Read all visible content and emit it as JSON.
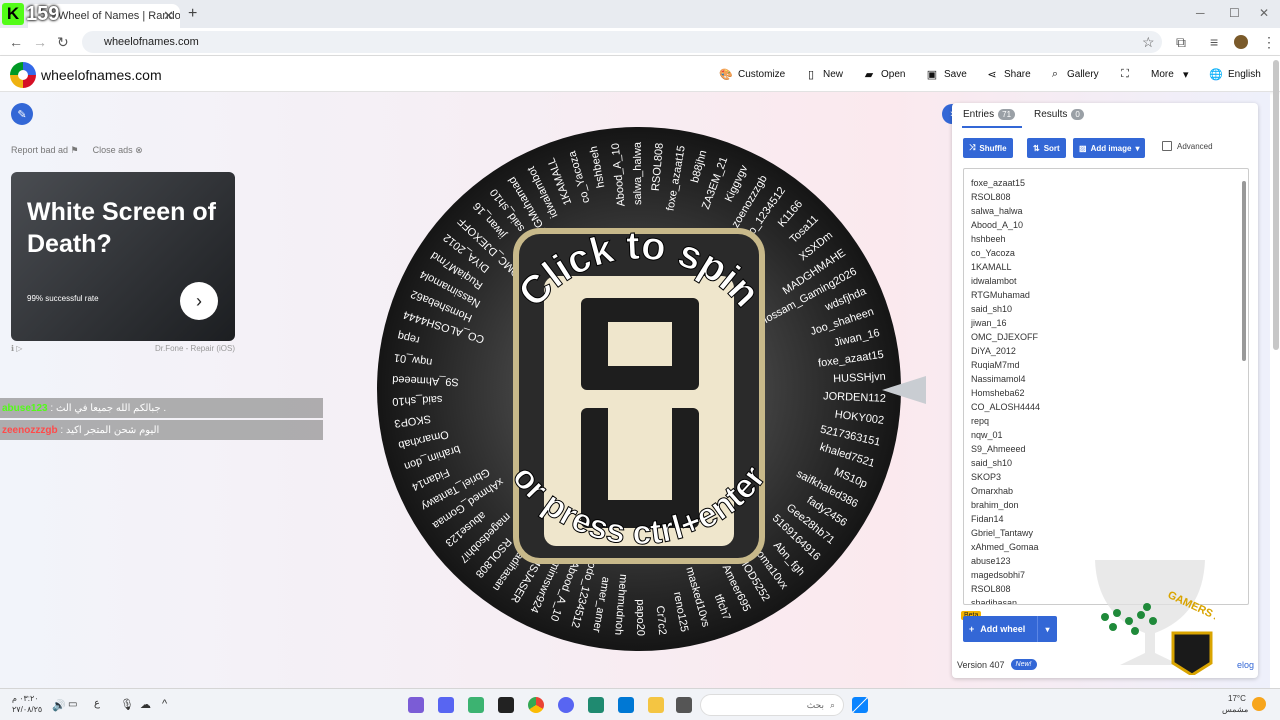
{
  "browser": {
    "tab_title": "Wheel of Names | Random name picker",
    "url": "wheelofnames.com",
    "overlay_counter": "159"
  },
  "header": {
    "site_title": "wheelofnames.com",
    "customize": "Customize",
    "new": "New",
    "open": "Open",
    "save": "Save",
    "share": "Share",
    "gallery": "Gallery",
    "more": "More",
    "language": "English"
  },
  "ads": {
    "report": "Report bad ad",
    "close": "Close ads",
    "headline": "White Screen of Death?",
    "rate": "99% successful rate",
    "advertiser": "Dr.Fone - Repair (iOS)"
  },
  "chat": [
    {
      "user": "abuse123",
      "message": "جبالكم الله جميعا في الث ."
    },
    {
      "user": "zeenozzzgb",
      "message": "اليوم شحن المتجر اكيد"
    }
  ],
  "wheel": {
    "spin_text": "Click to spin",
    "press_text": "or press ctrl+enter",
    "names": [
      "foxe_azaat15",
      "b88jhn",
      "ZA3EM_21",
      "Kiggvgv",
      "zoenozzzgb",
      "Dodo_1234512",
      "K1166",
      "Tosa11",
      "XSXDm",
      "MADGHMAHE",
      "Hossam_Gaming2026",
      "wdsfjhda",
      "Joo_shaheen",
      "Jiwan_16",
      "foxe_azaat15",
      "HUSSHjvn",
      "JORDEN112",
      "HOKY002",
      "5217363151",
      "khaled7521",
      "MS10p",
      "saifkhaled386",
      "fady2456",
      "Gee28hb71",
      "5169164916",
      "Abn_fgh",
      "edSoma10vx",
      "M7MOD5252",
      "Ameer695",
      "tffch7",
      "masked10vs",
      "reno125",
      "Cr7c2",
      "papo20",
      "mehmudnoh",
      "amer_amer",
      "Dodo_1234512",
      "Abood_A_10",
      "skhmimswr924",
      "MSJASER",
      "shadihasan",
      "RSOL808",
      "magedsobhi7",
      "abuse123",
      "xAhmed_Gomaa",
      "Gbriel_Tantawy",
      "Fidan14",
      "brahim_don",
      "Omarxhab",
      "SKOP3",
      "said_sh10",
      "S9_Ahmeeed",
      "nqw_01",
      "repq",
      "CO_ALOSH4444",
      "Homsheba62",
      "Nassimamol4",
      "RuqiaM7md",
      "DiYA_2012",
      "OMC_DJEXOFF",
      "jiwan_16",
      "said_sh10",
      "RTGMuhamad",
      "idwalambot",
      "1KAMALL",
      "co_Yacoza",
      "hshbeeh",
      "Abood_A_10",
      "salwa_halwa",
      "RSOL808"
    ]
  },
  "panel": {
    "entries_label": "Entries",
    "entries_count": "71",
    "results_label": "Results",
    "results_count": "0",
    "shuffle": "Shuffle",
    "sort": "Sort",
    "add_image": "Add image",
    "advanced": "Advanced",
    "entries": [
      "foxe_azaat15",
      "RSOL808",
      "salwa_halwa",
      "Abood_A_10",
      "hshbeeh",
      "co_Yacoza",
      "1KAMALL",
      "idwalambot",
      "RTGMuhamad",
      "said_sh10",
      "jiwan_16",
      "OMC_DJEXOFF",
      "DiYA_2012",
      "RuqiaM7md",
      "Nassimamol4",
      "Homsheba62",
      "CO_ALOSH4444",
      "repq",
      "nqw_01",
      "S9_Ahmeeed",
      "said_sh10",
      "SKOP3",
      "Omarxhab",
      "brahim_don",
      "Fidan14",
      "Gbriel_Tantawy",
      "xAhmed_Gomaa",
      "abuse123",
      "magedsobhi7",
      "RSOL808",
      "shadihasan"
    ],
    "beta": "Beta",
    "add_wheel": "Add wheel",
    "version": "Version 407",
    "new_badge": "New!",
    "changelog": "elog"
  },
  "overlay": {
    "watermark": "GAMERS ARENA"
  },
  "taskbar": {
    "time": "٠٣:٢٠ م",
    "date": "٢٧/٠٨/٢٥",
    "lang": "ع",
    "search": "بحث",
    "temp": "17°C",
    "weather": "مشمس"
  },
  "colors": {
    "accent": "#3367d6",
    "kick_green": "#53fc18"
  }
}
